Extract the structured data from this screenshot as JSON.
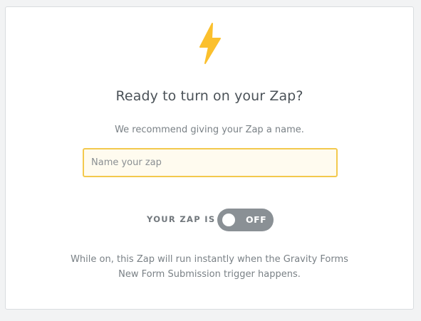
{
  "icon": {
    "name": "lightning-bolt-icon",
    "color": "#fbc02d"
  },
  "heading": "Ready to turn on your Zap?",
  "subheading": "We recommend giving your Zap a name.",
  "name_field": {
    "value": "",
    "placeholder": "Name your zap"
  },
  "status": {
    "label": "YOUR ZAP IS",
    "toggle_text": "OFF",
    "state": "off"
  },
  "description": {
    "line1": "While on, this Zap will run instantly when the Gravity Forms",
    "line2": "New Form Submission trigger happens."
  },
  "colors": {
    "accent_border": "#f3c94d",
    "input_background": "#fffbef",
    "toggle_off": "#8a9095"
  }
}
